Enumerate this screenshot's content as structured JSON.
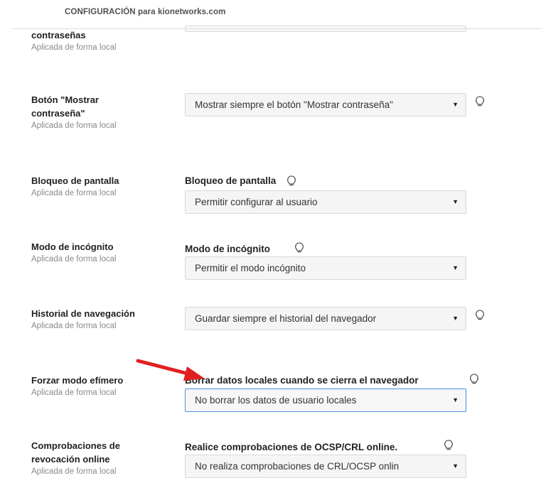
{
  "header": {
    "title": "CONFIGURACIÓN para kionetworks.com"
  },
  "settings": [
    {
      "label": "contraseñas",
      "sub": "Aplicada de forma local"
    },
    {
      "label": "Botón \"Mostrar contraseña\"",
      "sub": "Aplicada de forma local",
      "select_value": "Mostrar siempre el botón \"Mostrar contraseña\""
    },
    {
      "label": "Bloqueo de pantalla",
      "sub": "Aplicada de forma local",
      "control_title": "Bloqueo de pantalla",
      "select_value": "Permitir configurar al usuario"
    },
    {
      "label": "Modo de incógnito",
      "sub": "Aplicada de forma local",
      "control_title": "Modo de incógnito",
      "select_value": "Permitir el modo incógnito"
    },
    {
      "label": "Historial de navegación",
      "sub": "Aplicada de forma local",
      "select_value": "Guardar siempre el historial del navegador"
    },
    {
      "label": "Forzar modo efímero",
      "sub": "Aplicada de forma local",
      "control_title": "Borrar datos locales cuando se cierra el navegador",
      "select_value": "No borrar los datos de usuario locales"
    },
    {
      "label": "Comprobaciones de revocación online",
      "sub": "Aplicada de forma local",
      "control_title": "Realice comprobaciones de OCSP/CRL online.",
      "select_value": "No realiza comprobaciones de CRL/OCSP onlin"
    }
  ],
  "colors": {
    "accent_focus": "#4a90e2",
    "annotation_arrow": "#e02020",
    "sub_text": "#8a8a8a"
  },
  "icons": {
    "caret": "▼",
    "hint": "lightbulb-icon"
  }
}
